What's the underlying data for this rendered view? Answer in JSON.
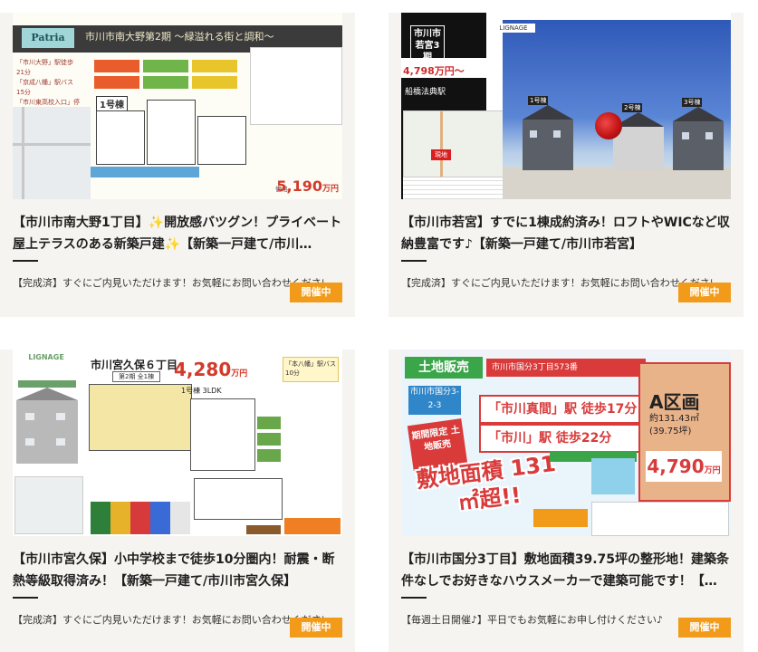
{
  "cards": [
    {
      "title": "【市川市南大野1丁目】✨開放感バツグン！プライベート屋上テラスのある新築戸建✨【新築一戸建て/市川…",
      "desc": "【完成済】すぐにご内見いただけます！お気軽にお問い合わせください",
      "badge": "開催中",
      "thumb": {
        "logo": "Patria",
        "header": "市川市南大野第2期 〜緑溢れる街と調和〜",
        "left_text": [
          "「市川大野」駅徒歩21分",
          "「京成八幡」駅バス15分",
          "「市川東高校入口」停歩8分"
        ],
        "price": "5,190",
        "price_unit": "万円",
        "unit_label": "1号棟"
      }
    },
    {
      "title": "【市川市若宮】すでに1棟成約済み！ロフトやWICなど収納豊富です♪【新築一戸建て/市川市若宮】",
      "desc": "【完成済】すぐにご内見いただけます！お気軽にお問い合わせください",
      "badge": "開催中",
      "thumb": {
        "area": "市川市若宮3期",
        "logo": "LIGNAGE",
        "price": "4,798万円～",
        "station": "船橋法典駅",
        "site": "現地",
        "labels": [
          "1号棟",
          "2号棟",
          "3号棟"
        ]
      }
    },
    {
      "title": "【市川市宮久保】小中学校まで徒歩10分圏内！耐震・断熱等級取得済み！【新築一戸建て/市川市宮久保】",
      "desc": "【完成済】すぐにご内見いただけます！お気軽にお問い合わせください",
      "badge": "開催中",
      "thumb": {
        "logo": "LIGNAGE",
        "title": "市川宮久保６丁目",
        "sub": "第2期 全1棟",
        "price": "4,280",
        "price_unit": "万円",
        "plan": "1号棟 3LDK",
        "note": "「本八幡」駅バス10分"
      }
    },
    {
      "title": "【市川市国分3丁目】敷地面積39.75坪の整形地！建築条件なしでお好きなハウスメーカーで建築可能です！【…",
      "desc": "【毎週土日開催♪】平日でもお気軽にお申し付けください♪",
      "badge": "開催中",
      "thumb": {
        "tag": "土地販売",
        "header": "市川市国分3丁目573番",
        "address": "市川市国分3-2-3",
        "station1": "「市川真間」駅 徒歩17分",
        "station2": "「市川」駅 徒歩22分",
        "limited": "期間限定 土地販売",
        "big": "敷地面積 131㎡超!!",
        "lot": "A区画",
        "lot_area": "約131.43㎡",
        "lot_tsubo": "(39.75坪)",
        "lot_price": "4,790",
        "lot_unit": "万円"
      }
    }
  ]
}
